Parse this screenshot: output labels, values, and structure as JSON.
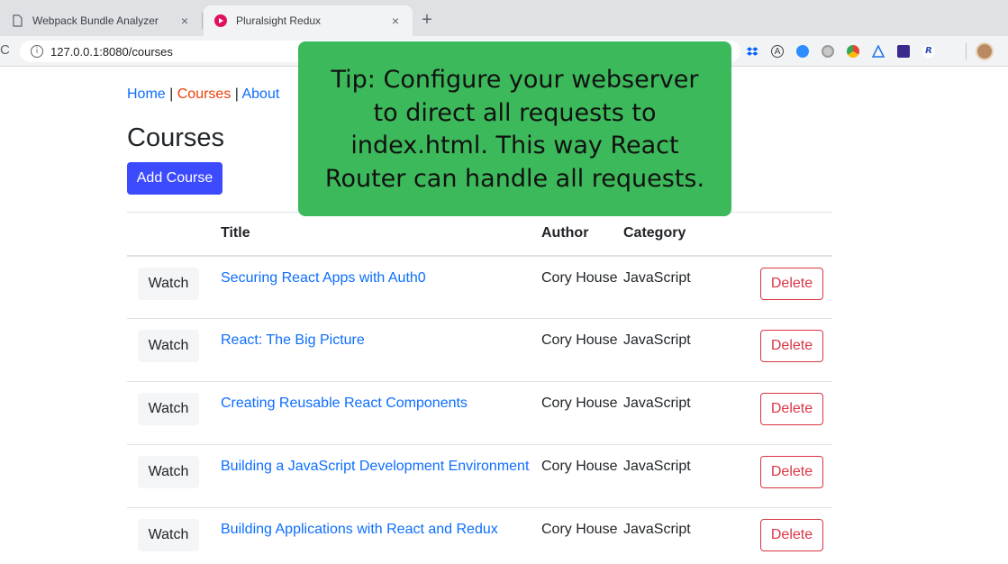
{
  "browser": {
    "tabs": [
      {
        "title": "Webpack Bundle Analyzer",
        "active": false,
        "close": "×"
      },
      {
        "title": "Pluralsight Redux",
        "active": true,
        "close": "×"
      }
    ],
    "new_tab": "+",
    "url": "127.0.0.1:8080/courses",
    "reload_glyph": "C",
    "info_glyph": "i"
  },
  "nav": {
    "home": "Home",
    "courses": "Courses",
    "about": "About",
    "separator": " | "
  },
  "page": {
    "title": "Courses",
    "add_button": "Add Course"
  },
  "table": {
    "headers": [
      "",
      "Title",
      "Author",
      "Category",
      ""
    ],
    "rows": [
      {
        "watch": "Watch",
        "title": "Securing React Apps with Auth0",
        "author": "Cory House",
        "category": "JavaScript",
        "delete": "Delete"
      },
      {
        "watch": "Watch",
        "title": "React: The Big Picture",
        "author": "Cory House",
        "category": "JavaScript",
        "delete": "Delete"
      },
      {
        "watch": "Watch",
        "title": "Creating Reusable React Components",
        "author": "Cory House",
        "category": "JavaScript",
        "delete": "Delete"
      },
      {
        "watch": "Watch",
        "title": "Building a JavaScript Development Environment",
        "author": "Cory House",
        "category": "JavaScript",
        "delete": "Delete"
      },
      {
        "watch": "Watch",
        "title": "Building Applications with React and Redux",
        "author": "Cory House",
        "category": "JavaScript",
        "delete": "Delete"
      }
    ]
  },
  "tip": {
    "lines": [
      "Tip: Configure your webserver",
      "to direct all requests to",
      "index.html. This way React",
      "Router can handle all requests."
    ]
  },
  "colors": {
    "link": "#0d6efd",
    "active_nav": "#e8400c",
    "primary_button": "#3d4bff",
    "danger": "#dc3545",
    "tip_background": "#3cb95a"
  },
  "extensions": [
    "dropbox-icon",
    "a-icon",
    "zoom-icon",
    "circle-icon",
    "chrome-icon",
    "triangle-icon",
    "book-icon",
    "r-icon"
  ]
}
